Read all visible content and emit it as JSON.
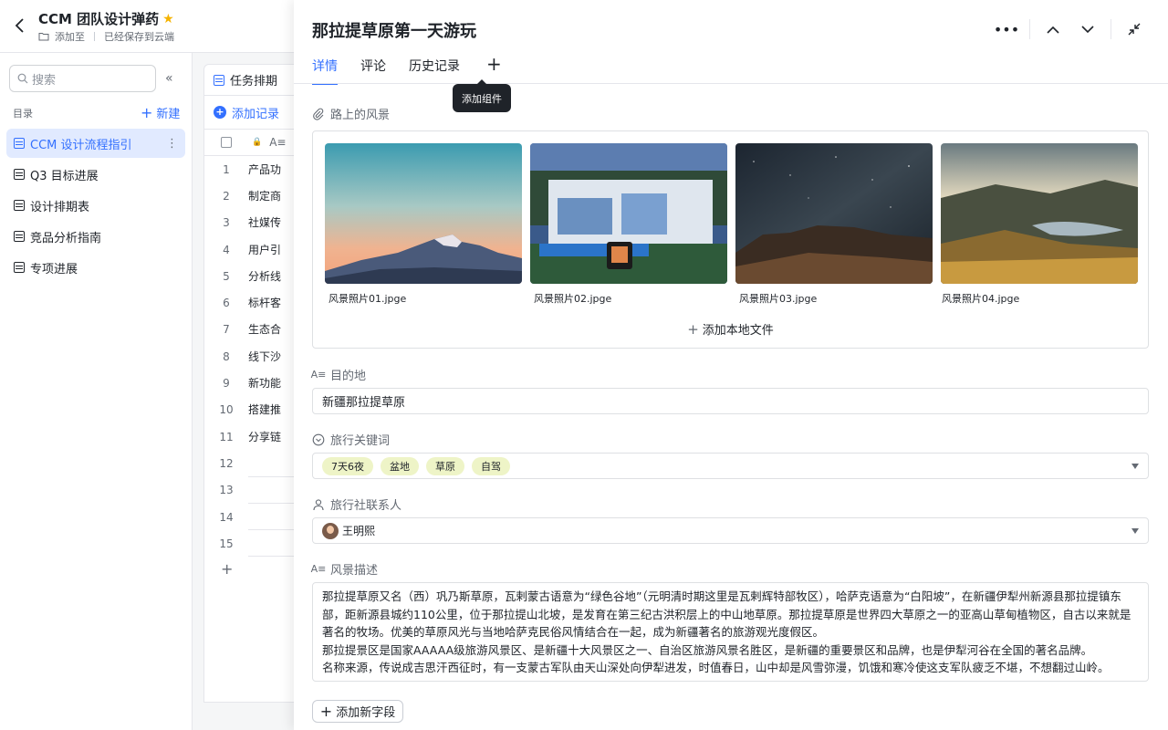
{
  "header": {
    "doc_title": "CCM 团队设计弹药",
    "add_to": "添加至",
    "saved_status": "已经保存到云端"
  },
  "sidebar": {
    "search_placeholder": "搜索",
    "section_label": "目录",
    "new_label": "新建",
    "items": [
      {
        "label": "CCM 设计流程指引",
        "active": true
      },
      {
        "label": "Q3 目标进展"
      },
      {
        "label": "设计排期表"
      },
      {
        "label": "竞品分析指南"
      },
      {
        "label": "专项进展"
      }
    ]
  },
  "table": {
    "tab_label": "任务排期",
    "add_record": "添加记录",
    "rows": [
      {
        "num": "1",
        "text": "产品功"
      },
      {
        "num": "2",
        "text": "制定商"
      },
      {
        "num": "3",
        "text": "社媒传"
      },
      {
        "num": "4",
        "text": "用户引"
      },
      {
        "num": "5",
        "text": "分析线"
      },
      {
        "num": "6",
        "text": "标杆客"
      },
      {
        "num": "7",
        "text": "生态合"
      },
      {
        "num": "8",
        "text": "线下沙"
      },
      {
        "num": "9",
        "text": "新功能"
      },
      {
        "num": "10",
        "text": "搭建推"
      },
      {
        "num": "11",
        "text": "分享链"
      },
      {
        "num": "12",
        "text": ""
      },
      {
        "num": "13",
        "text": ""
      },
      {
        "num": "14",
        "text": ""
      },
      {
        "num": "15",
        "text": ""
      }
    ]
  },
  "panel": {
    "title": "那拉提草原第一天游玩",
    "tabs": [
      "详情",
      "评论",
      "历史记录"
    ],
    "tooltip": "添加组件",
    "attachment": {
      "label": "路上的风景",
      "files": [
        "风景照片01.jpge",
        "风景照片02.jpge",
        "风景照片03.jpge",
        "风景照片04.jpge"
      ],
      "add_local": "添加本地文件"
    },
    "destination": {
      "label": "目的地",
      "value": "新疆那拉提草原"
    },
    "keywords": {
      "label": "旅行关键词",
      "tags": [
        "7天6夜",
        "盆地",
        "草原",
        "自驾"
      ]
    },
    "contact": {
      "label": "旅行社联系人",
      "value": "王明熙"
    },
    "description": {
      "label": "风景描述",
      "para1": "那拉提草原又名（西）巩乃斯草原，瓦剌蒙古语意为“绿色谷地”（元明清时期这里是瓦剌辉特部牧区），哈萨克语意为“白阳坡”，在新疆伊犁州新源县那拉提镇东部，距新源县城约110公里，位于那拉提山北坡，是发育在第三纪古洪积层上的中山地草原。那拉提草原是世界四大草原之一的亚高山草甸植物区，自古以来就是著名的牧场。优美的草原风光与当地哈萨克民俗风情结合在一起，成为新疆著名的旅游观光度假区。",
      "para2": "那拉提景区是国家AAAAA级旅游风景区、是新疆十大风景区之一、自治区旅游风景名胜区，是新疆的重要景区和品牌，也是伊犁河谷在全国的著名品牌。",
      "para3": "名称来源，传说成吉思汗西征时，有一支蒙古军队由天山深处向伊犁进发，时值春日，山中却是风雪弥漫，饥饿和寒冷使这支军队疲乏不堪，不想翻过山岭。"
    },
    "add_field": "添加新字段"
  },
  "colors": {
    "accent": "#3370ff",
    "tag_bg": "#eef4c7",
    "star": "#f5b300"
  }
}
